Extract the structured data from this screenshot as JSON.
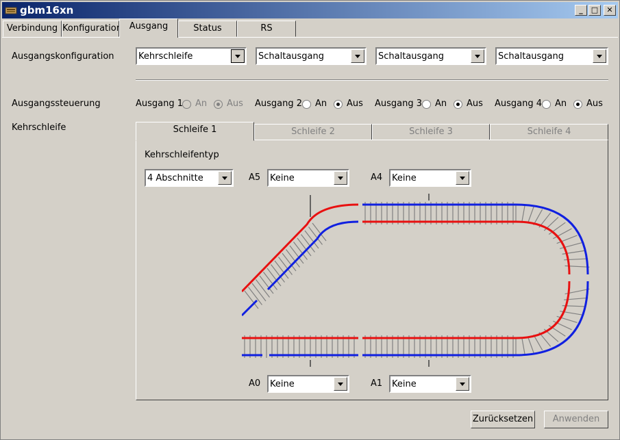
{
  "window": {
    "title": "gbm16xn",
    "minimize": "_",
    "maximize": "□",
    "close": "✕"
  },
  "tabs": [
    "Verbindung",
    "Konfiguration",
    "Ausgang",
    "Status",
    "RS"
  ],
  "active_tab": "Ausgang",
  "config": {
    "label": "Ausgangskonfiguration",
    "combos": [
      "Kehrschleife",
      "Schaltausgang",
      "Schaltausgang",
      "Schaltausgang"
    ]
  },
  "control": {
    "label": "Ausgangssteuerung",
    "on_label": "An",
    "off_label": "Aus",
    "outputs": [
      {
        "name": "Ausgang 1",
        "state": "Aus",
        "disabled": true
      },
      {
        "name": "Ausgang 2",
        "state": "Aus",
        "disabled": false
      },
      {
        "name": "Ausgang 3",
        "state": "Aus",
        "disabled": false
      },
      {
        "name": "Ausgang 4",
        "state": "Aus",
        "disabled": false
      }
    ]
  },
  "loop": {
    "label": "Kehrschleife",
    "tabs": [
      "Schleife 1",
      "Schleife 2",
      "Schleife 3",
      "Schleife 4"
    ],
    "type_label": "Kehrschleifentyp",
    "type_value": "4 Abschnitte",
    "sections": {
      "A5": {
        "label": "A5",
        "value": "Keine"
      },
      "A4": {
        "label": "A4",
        "value": "Keine"
      },
      "A0": {
        "label": "A0",
        "value": "Keine"
      },
      "A1": {
        "label": "A1",
        "value": "Keine"
      }
    },
    "colors": {
      "rail_red": "#e81010",
      "rail_blue": "#1020e0",
      "sleeper": "#808080"
    }
  },
  "buttons": {
    "reset": "Zurücksetzen",
    "apply": "Anwenden"
  }
}
